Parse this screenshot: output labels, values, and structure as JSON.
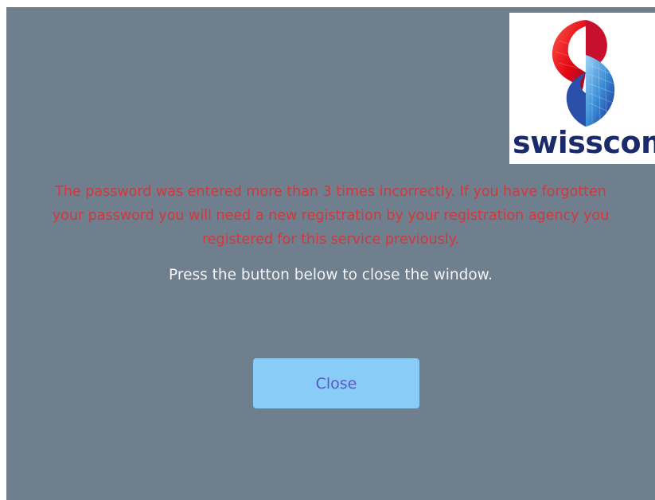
{
  "brand": {
    "logo_text": "swisscom",
    "colors": {
      "red": "#e30613",
      "blue": "#1b2a6b",
      "light_blue": "#3a8fd8"
    }
  },
  "message": {
    "error_lines": [
      "The password was entered more than 3 times incorrectly. If you have forgotten",
      "your password you will need a new registration by your registration agency you",
      "registered for this service previously."
    ],
    "instruction": "Press the button below to close the window."
  },
  "actions": {
    "close_label": "Close"
  },
  "colors": {
    "background": "#6f7f8d",
    "error": "#d4373c",
    "button": "#88ccf7",
    "button_text": "#5a59c0"
  }
}
